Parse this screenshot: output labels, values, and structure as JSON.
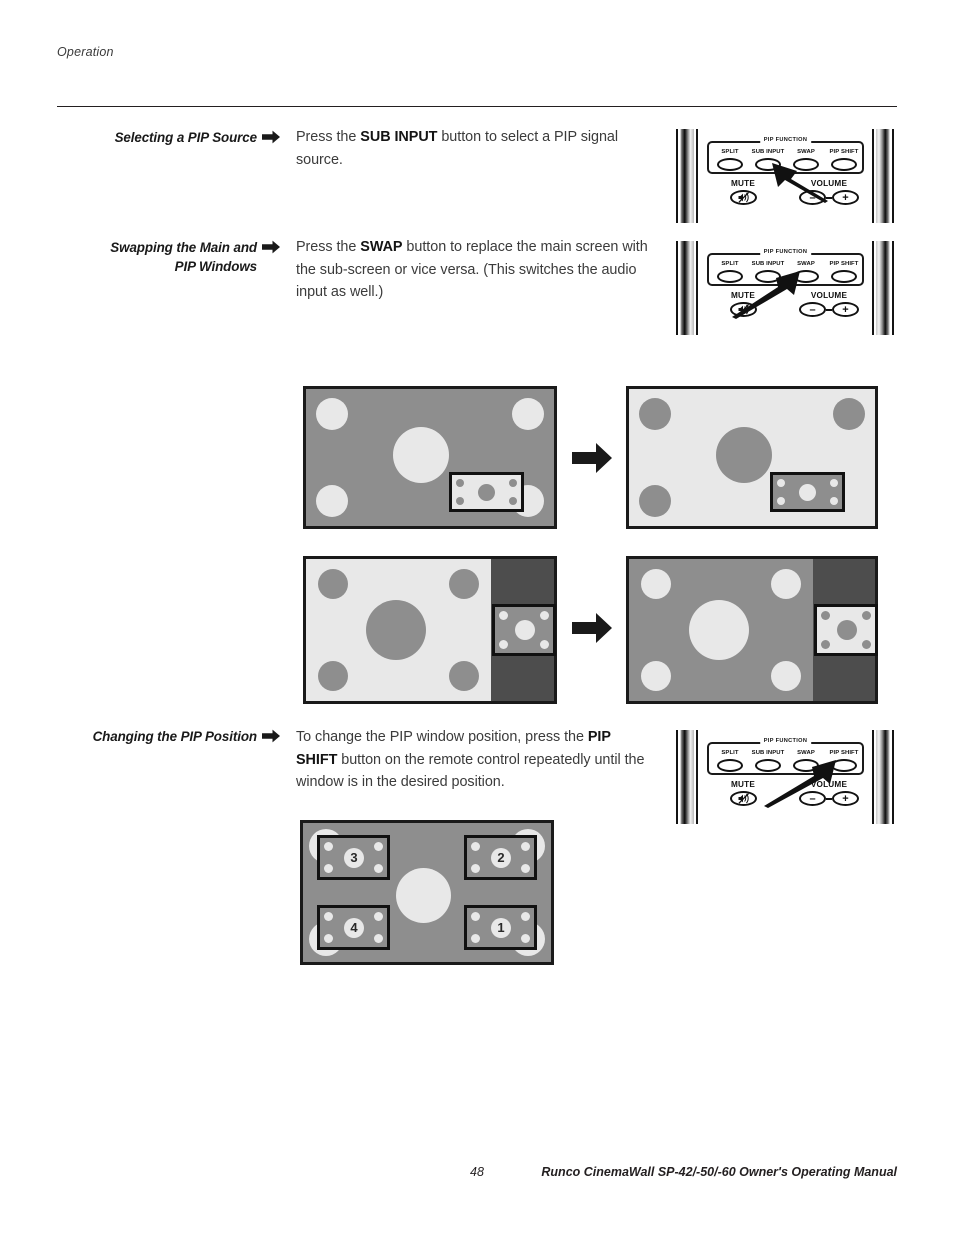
{
  "page": {
    "header": "Operation",
    "footer_page_number": "48",
    "footer_title": "Runco CinemaWall SP-42/-50/-60 Owner's Operating Manual"
  },
  "sections": [
    {
      "heading_lines": [
        "Selecting a PIP Source"
      ],
      "body_html": "Press the <b>SUB INPUT</b> button to select a PIP signal source.",
      "pointer_target": "SUB INPUT"
    },
    {
      "heading_lines": [
        "Swapping the Main and",
        "PIP Windows"
      ],
      "body_html": "Press the <b>SWAP</b> button to replace the main screen with the sub-screen or vice versa. (This switches the audio input as well.)",
      "pointer_target": "SWAP"
    },
    {
      "heading_lines": [
        "Changing the PIP Position"
      ],
      "body_html": "To change the PIP window position, press the <b>PIP SHIFT</b> button on the remote control repeatedly until the window is in the desired position.",
      "pointer_target": "PIP SHIFT"
    }
  ],
  "remote": {
    "group_label": "PIP FUNCTION",
    "pip_buttons": [
      "SPLIT",
      "SUB INPUT",
      "SWAP",
      "PIP SHIFT"
    ],
    "mute_label": "MUTE",
    "mute_icon": "speaker-mute-icon",
    "volume_label": "VOLUME",
    "volume_minus": "–",
    "volume_plus": "+"
  },
  "illustrations": {
    "flow_arrow_icon": "right-arrow-icon",
    "pip_positions": [
      "3",
      "2",
      "4",
      "1"
    ],
    "colors": {
      "screen_gray": "#8e8e8e",
      "screen_light": "#e8e8e8",
      "side_band": "#4d4d4d",
      "outline": "#1a1a1a"
    }
  }
}
